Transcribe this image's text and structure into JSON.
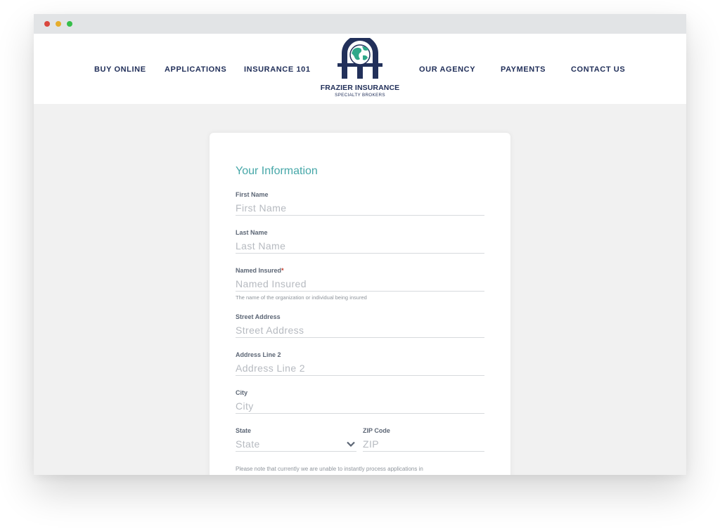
{
  "nav": {
    "left": [
      "BUY ONLINE",
      "APPLICATIONS",
      "INSURANCE 101"
    ],
    "right": [
      "OUR AGENCY",
      "PAYMENTS",
      "CONTACT US"
    ]
  },
  "logo": {
    "name": "FRAZIER INSURANCE",
    "tagline": "SPECIALTY BROKERS"
  },
  "form": {
    "section_title": "Your Information",
    "fields": {
      "first_name": {
        "label": "First Name",
        "placeholder": "First Name"
      },
      "last_name": {
        "label": "Last Name",
        "placeholder": "Last Name"
      },
      "named_insured": {
        "label": "Named Insured",
        "required_mark": "*",
        "placeholder": "Named Insured",
        "help": "The name of the organization or individual being insured"
      },
      "street_address": {
        "label": "Street Address",
        "placeholder": "Street Address"
      },
      "address_line_2": {
        "label": "Address Line 2",
        "placeholder": "Address Line 2"
      },
      "city": {
        "label": "City",
        "placeholder": "City"
      },
      "state": {
        "label": "State",
        "selected": "State"
      },
      "zip": {
        "label": "ZIP Code",
        "placeholder": "ZIP"
      }
    },
    "notice": "Please note that currently we are unable to instantly process applications in"
  },
  "colors": {
    "navy": "#22305a",
    "teal_accent": "#46a7a8",
    "globe_green": "#2fa88a",
    "page_bg": "#f1f1f1"
  },
  "icons": {
    "logo": "globe-emblem-icon",
    "select": "chevron-down-icon"
  }
}
